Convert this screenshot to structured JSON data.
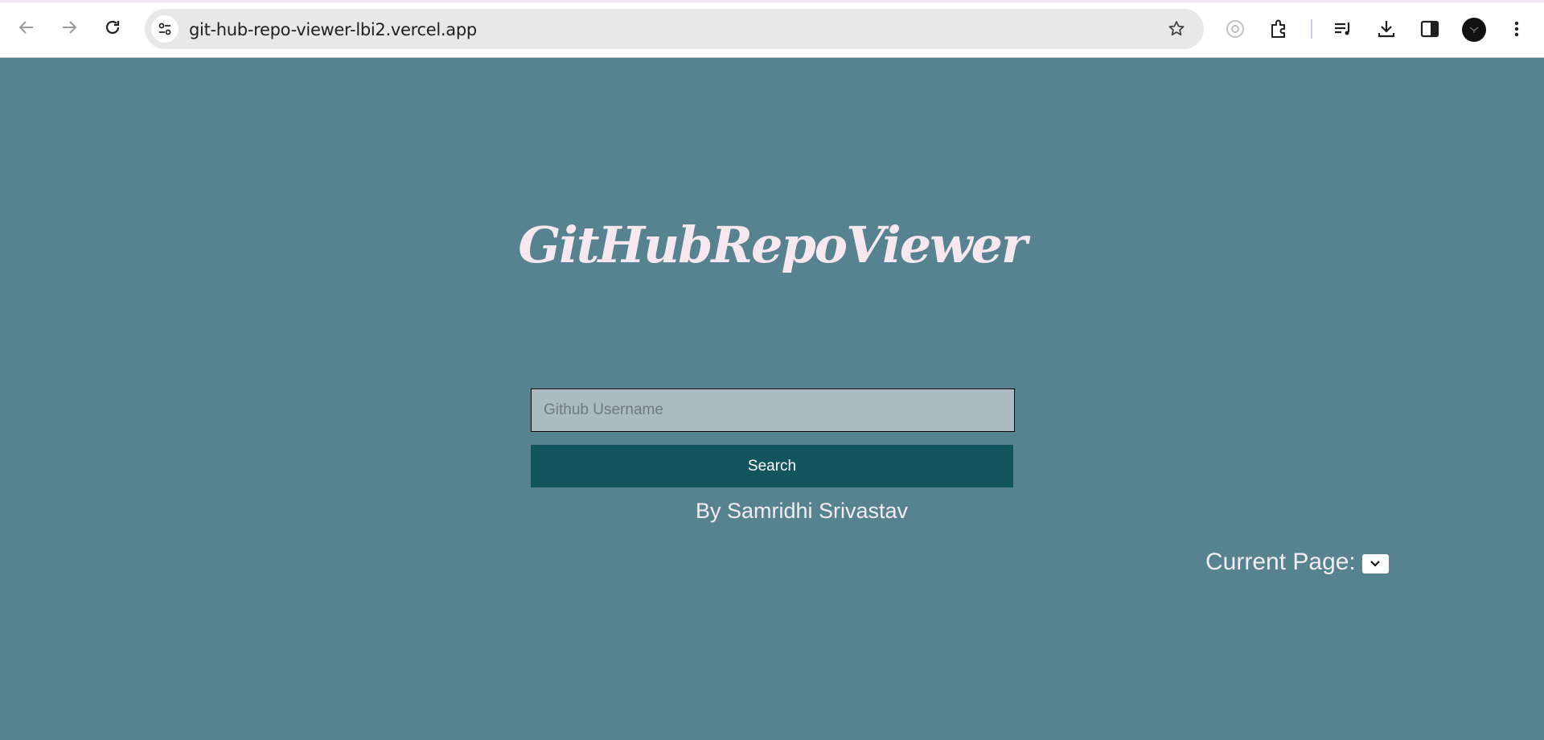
{
  "browser": {
    "url": "git-hub-repo-viewer-lbi2.vercel.app",
    "icons": [
      "back-arrow-icon",
      "forward-arrow-icon",
      "reload-icon",
      "site-info-icon",
      "bookmark-star-icon",
      "lens-icon",
      "extensions-icon",
      "media-queue-icon",
      "download-icon",
      "side-panel-icon",
      "profile-avatar",
      "more-menu-icon"
    ]
  },
  "page": {
    "title": "GitHubRepoViewer",
    "search_placeholder": "Github Username",
    "search_button": "Search",
    "byline": "By Samridhi Srivastav",
    "current_page_label": "Current Page:"
  },
  "colors": {
    "background": "#57828f",
    "button": "#12555d",
    "input": "#aabbc1",
    "title_text": "#f6e8ee"
  }
}
